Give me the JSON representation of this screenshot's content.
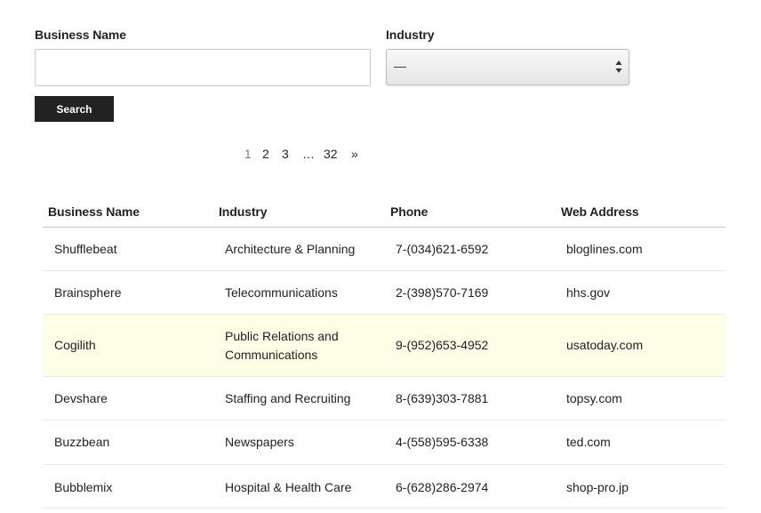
{
  "form": {
    "business_label": "Business Name",
    "business_value": "",
    "industry_label": "Industry",
    "industry_selected": "—",
    "search_label": "Search"
  },
  "pagination": {
    "pages": [
      "1",
      "2",
      "3",
      "…",
      "32",
      "»"
    ],
    "current": "1"
  },
  "table": {
    "columns": [
      "Business Name",
      "Industry",
      "Phone",
      "Web Address"
    ],
    "rows": [
      [
        "Shufflebeat",
        "Architecture & Planning",
        "7-(034)621-6592",
        "bloglines.com"
      ],
      [
        "Brainsphere",
        "Telecommunications",
        "2-(398)570-7169",
        "hhs.gov"
      ],
      [
        "Cogilith",
        "Public Relations and Communications",
        "9-(952)653-4952",
        "usatoday.com"
      ],
      [
        "Devshare",
        "Staffing and Recruiting",
        "8-(639)303-7881",
        "topsy.com"
      ],
      [
        "Buzzbean",
        "Newspapers",
        "4-(558)595-6338",
        "ted.com"
      ],
      [
        "Bubblemix",
        "Hospital & Health Care",
        "6-(628)286-2974",
        "shop-pro.jp"
      ]
    ],
    "highlighted_row": 2,
    "highlight_color": "#fefde6"
  },
  "colors": {
    "text": "#222222",
    "button_bg": "#222222",
    "button_text": "#ffffff",
    "current_page": "#767676"
  }
}
